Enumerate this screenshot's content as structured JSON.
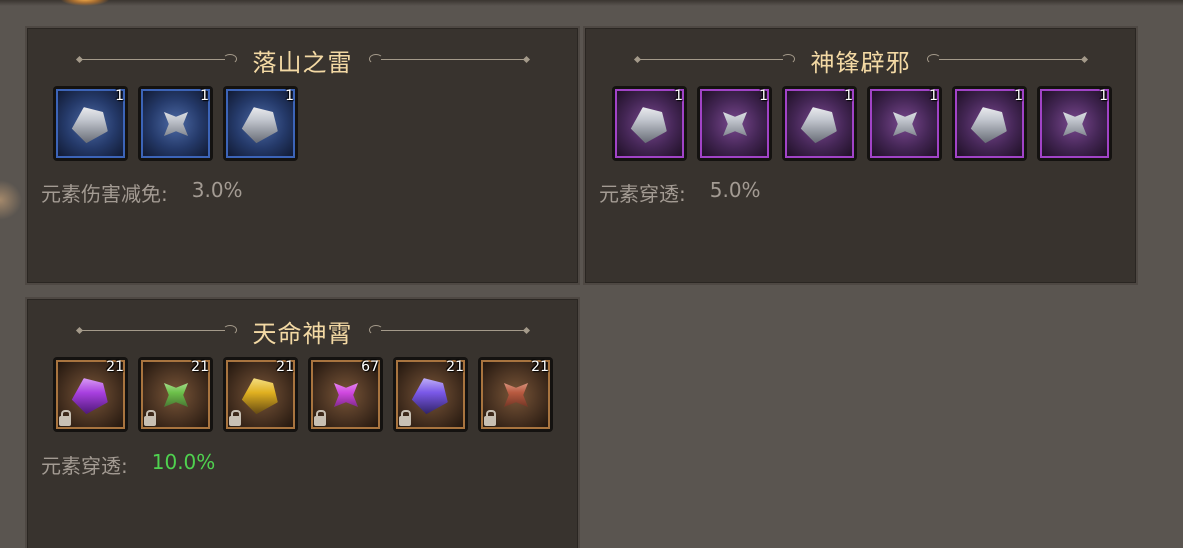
{
  "panels": [
    {
      "title": "落山之雷",
      "rarity": "blue",
      "items": [
        {
          "icon": "silver-armor-piece-icon",
          "count": "1"
        },
        {
          "icon": "silver-spiked-gauntlet-icon",
          "count": "1"
        },
        {
          "icon": "silver-pauldron-icon",
          "count": "1"
        }
      ],
      "stat": {
        "label": "元素伤害减免:",
        "value": "3.0%"
      }
    },
    {
      "title": "神锋辟邪",
      "rarity": "purple",
      "items": [
        {
          "icon": "silver-helmet-icon",
          "count": "1"
        },
        {
          "icon": "silver-gauntlet-icon",
          "count": "1"
        },
        {
          "icon": "silver-claw-icon",
          "count": "1"
        },
        {
          "icon": "silver-horned-crest-icon",
          "count": "1"
        },
        {
          "icon": "silver-blade-icon",
          "count": "1"
        },
        {
          "icon": "dark-orb-armor-icon",
          "count": "1"
        }
      ],
      "stat": {
        "label": "元素穿透:",
        "value": "5.0%"
      }
    },
    {
      "title": "天命神霄",
      "rarity": "orange",
      "items": [
        {
          "icon": "violet-crystal-gear-icon",
          "count": "21",
          "locked": true
        },
        {
          "icon": "green-crystal-gear-icon",
          "count": "21",
          "locked": true
        },
        {
          "icon": "gold-crystal-gear-icon",
          "count": "21",
          "locked": true
        },
        {
          "icon": "magenta-crystal-gear-icon",
          "count": "67",
          "locked": true
        },
        {
          "icon": "blue-violet-crystal-gear-icon",
          "count": "21",
          "locked": true
        },
        {
          "icon": "red-crystal-gear-icon",
          "count": "21",
          "locked": true
        }
      ],
      "stat": {
        "label": "元素穿透:",
        "value": "10.0%"
      }
    }
  ],
  "colors": {
    "title": "#f3d9a4",
    "stat_label": "#a39b93",
    "stat_value_highlight": "#4fd24f",
    "blue_frame": "#3c64b8",
    "purple_frame": "#a143c7",
    "orange_frame": "#a8743f"
  }
}
